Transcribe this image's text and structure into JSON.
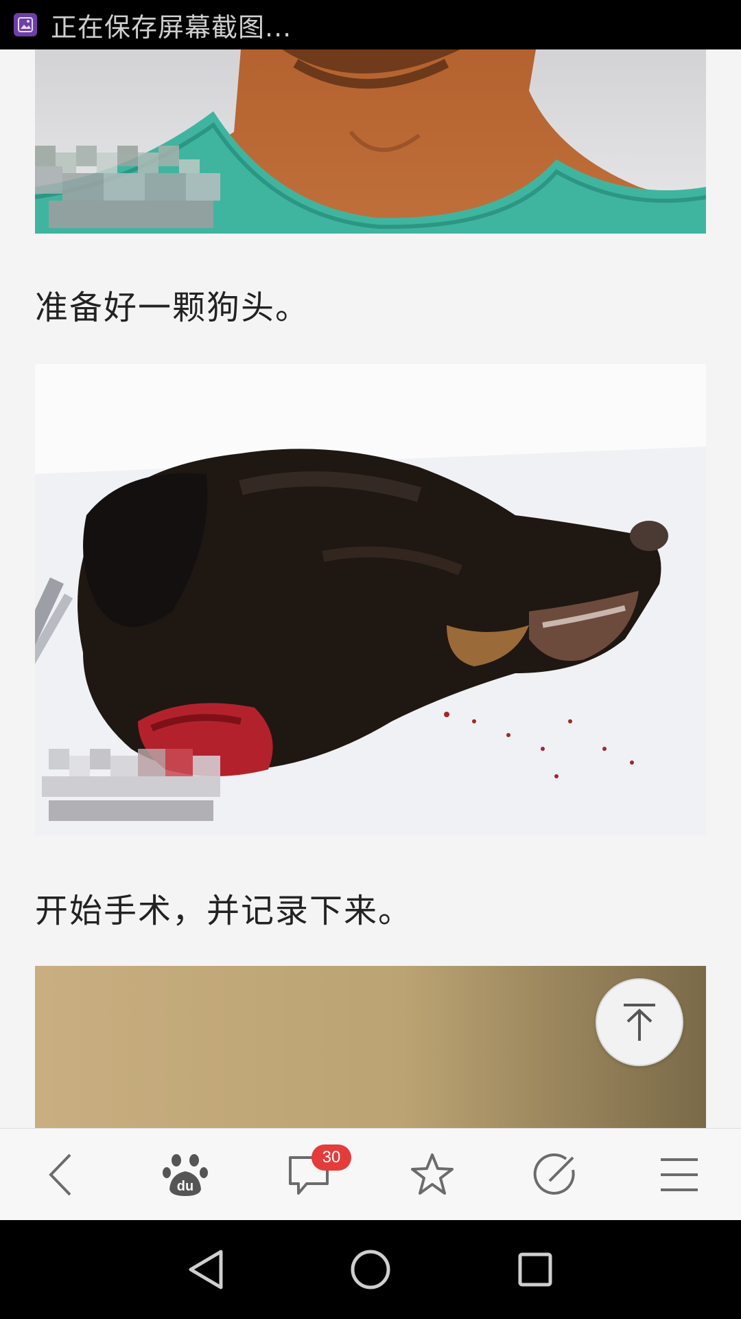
{
  "status_bar": {
    "message": "正在保存屏幕截图..."
  },
  "article": {
    "captions": [
      "准备好一颗狗头。",
      "开始手术，并记录下来。"
    ]
  },
  "toolbar": {
    "items": [
      {
        "icon": "back-chevron-icon"
      },
      {
        "icon": "baidu-paw-icon",
        "label": "du"
      },
      {
        "icon": "comment-icon",
        "badge": "30"
      },
      {
        "icon": "star-icon"
      },
      {
        "icon": "compose-icon"
      },
      {
        "icon": "menu-icon"
      }
    ]
  },
  "nav_bar": {
    "items": [
      "back-triangle-icon",
      "home-circle-icon",
      "recents-square-icon"
    ]
  },
  "colors": {
    "status_bar": "#000000",
    "badge": "#e43b3b",
    "page_background": "#f4f4f4"
  }
}
